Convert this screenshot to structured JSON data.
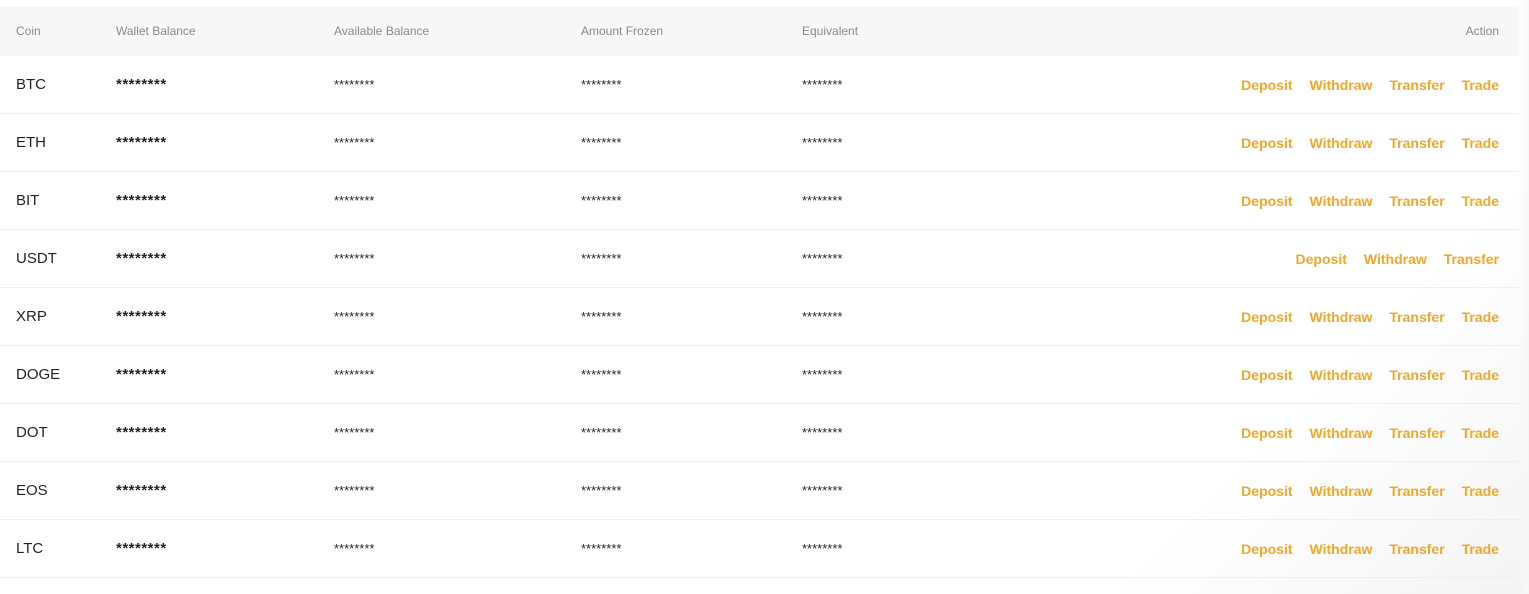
{
  "table": {
    "headers": {
      "coin": "Coin",
      "wallet_balance": "Wallet Balance",
      "available_balance": "Available Balance",
      "amount_frozen": "Amount Frozen",
      "equivalent": "Equivalent",
      "action": "Action"
    },
    "action_labels": {
      "deposit": "Deposit",
      "withdraw": "Withdraw",
      "transfer": "Transfer",
      "trade": "Trade"
    },
    "rows": [
      {
        "coin": "BTC",
        "wallet_balance": "********",
        "available_balance": "********",
        "amount_frozen": "********",
        "equivalent": "********",
        "actions": [
          "Deposit",
          "Withdraw",
          "Transfer",
          "Trade"
        ]
      },
      {
        "coin": "ETH",
        "wallet_balance": "********",
        "available_balance": "********",
        "amount_frozen": "********",
        "equivalent": "********",
        "actions": [
          "Deposit",
          "Withdraw",
          "Transfer",
          "Trade"
        ]
      },
      {
        "coin": "BIT",
        "wallet_balance": "********",
        "available_balance": "********",
        "amount_frozen": "********",
        "equivalent": "********",
        "actions": [
          "Deposit",
          "Withdraw",
          "Transfer",
          "Trade"
        ]
      },
      {
        "coin": "USDT",
        "wallet_balance": "********",
        "available_balance": "********",
        "amount_frozen": "********",
        "equivalent": "********",
        "actions": [
          "Deposit",
          "Withdraw",
          "Transfer"
        ]
      },
      {
        "coin": "XRP",
        "wallet_balance": "********",
        "available_balance": "********",
        "amount_frozen": "********",
        "equivalent": "********",
        "actions": [
          "Deposit",
          "Withdraw",
          "Transfer",
          "Trade"
        ]
      },
      {
        "coin": "DOGE",
        "wallet_balance": "********",
        "available_balance": "********",
        "amount_frozen": "********",
        "equivalent": "********",
        "actions": [
          "Deposit",
          "Withdraw",
          "Transfer",
          "Trade"
        ]
      },
      {
        "coin": "DOT",
        "wallet_balance": "********",
        "available_balance": "********",
        "amount_frozen": "********",
        "equivalent": "********",
        "actions": [
          "Deposit",
          "Withdraw",
          "Transfer",
          "Trade"
        ]
      },
      {
        "coin": "EOS",
        "wallet_balance": "********",
        "available_balance": "********",
        "amount_frozen": "********",
        "equivalent": "********",
        "actions": [
          "Deposit",
          "Withdraw",
          "Transfer",
          "Trade"
        ]
      },
      {
        "coin": "LTC",
        "wallet_balance": "********",
        "available_balance": "********",
        "amount_frozen": "********",
        "equivalent": "********",
        "actions": [
          "Deposit",
          "Withdraw",
          "Transfer",
          "Trade"
        ]
      }
    ]
  },
  "colors": {
    "action_link": "#f0a82c",
    "header_background": "#f7f7f7",
    "header_text": "#8a8a8a",
    "cell_text": "#1e2329",
    "row_divider": "#efefef"
  }
}
